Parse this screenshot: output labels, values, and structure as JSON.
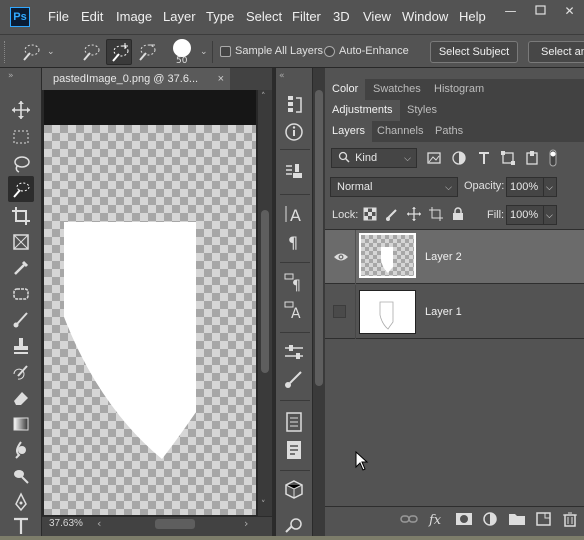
{
  "app": {
    "logo": "Ps"
  },
  "menu": [
    "File",
    "Edit",
    "Image",
    "Layer",
    "Type",
    "Select",
    "Filter",
    "3D",
    "View",
    "Window",
    "Help"
  ],
  "options_bar": {
    "brush_size": "50",
    "sample_all_layers": "Sample All Layers",
    "auto_enhance": "Auto-Enhance",
    "select_subject": "Select Subject",
    "select_and_mask": "Select and"
  },
  "document": {
    "tab_title": "pastedImage_0.png @ 37.6...",
    "close": "×",
    "zoom": "37.63%"
  },
  "panel_groups": {
    "top_tabs": [
      "Color",
      "Swatches",
      "Histogram"
    ],
    "mid_tabs": [
      "Adjustments",
      "Styles"
    ],
    "layer_tabs": [
      "Layers",
      "Channels",
      "Paths"
    ]
  },
  "layers_panel": {
    "filter_kind": "Kind",
    "blend_mode": "Normal",
    "opacity_label": "Opacity:",
    "opacity_value": "100%",
    "lock_label": "Lock:",
    "fill_label": "Fill:",
    "fill_value": "100%",
    "layers": [
      {
        "name": "Layer 2",
        "visible": true,
        "selected": true
      },
      {
        "name": "Layer 1",
        "visible": false,
        "selected": false
      }
    ]
  },
  "colors": {
    "accent": "#31a8ff",
    "panel": "#535353",
    "dark": "#282828"
  }
}
